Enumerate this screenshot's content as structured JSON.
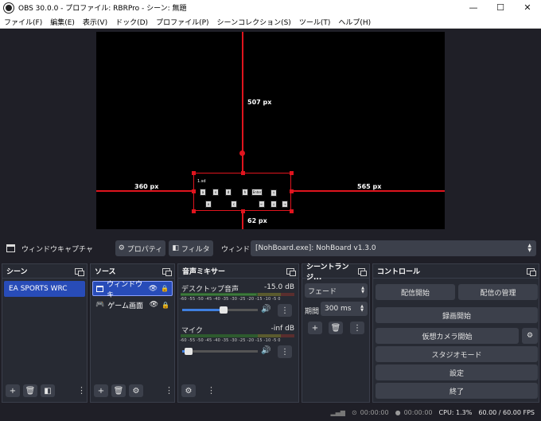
{
  "window": {
    "title": "OBS 30.0.0 - プロファイル: RBRPro - シーン: 無題",
    "minimize": "—",
    "maximize": "☐",
    "close": "✕"
  },
  "menu": [
    "ファイル(F)",
    "編集(E)",
    "表示(V)",
    "ドック(D)",
    "プロファイル(P)",
    "シーンコレクション(S)",
    "ツール(T)",
    "ヘルプ(H)"
  ],
  "preview": {
    "top_distance": "507 px",
    "left_distance": "360 px",
    "right_distance": "565 px",
    "bottom_distance": "62 px",
    "overlay_label": "1.sd",
    "keys": [
      "a",
      "s",
      "d",
      "h",
      "Enter",
      "↑",
      "x",
      "c",
      "←",
      "↓",
      "→"
    ]
  },
  "source_toolbar": {
    "selected_source": "ウィンドウキャプチャ",
    "properties_button": "プロパティ",
    "filters_button": "フィルタ",
    "window_label": "ウィンドウ",
    "window_value": "[NohBoard.exe]: NohBoard v1.3.0"
  },
  "scenes": {
    "title": "シーン",
    "items": [
      "EA SPORTS WRC"
    ]
  },
  "sources": {
    "title": "ソース",
    "items": [
      "ウィンドウキ",
      "ゲーム画面"
    ]
  },
  "mixer": {
    "title": "音声ミキサー",
    "scale": "-60 -55 -50 -45 -40 -35 -30 -25 -20 -15 -10 -5 0",
    "channels": [
      {
        "name": "デスクトップ音声",
        "level": "-15.0 dB",
        "volume": 0.55
      },
      {
        "name": "マイク",
        "level": "-inf dB",
        "volume": 0.08
      }
    ]
  },
  "transitions": {
    "title": "シーントランジ...",
    "type": "フェード",
    "duration_label": "期間",
    "duration_value": "300 ms"
  },
  "controls": {
    "title": "コントロール",
    "start_streaming": "配信開始",
    "manage_stream": "配信の管理",
    "start_recording": "録画開始",
    "start_virtualcam": "仮想カメラ開始",
    "studio_mode": "スタジオモード",
    "settings": "設定",
    "exit": "終了"
  },
  "status": {
    "stream_time": "00:00:00",
    "record_time": "00:00:00",
    "cpu": "CPU: 1.3%",
    "fps": "60.00 / 60.00 FPS"
  },
  "colors": {
    "accent": "#e0141e",
    "selected": "#284cb8",
    "panel": "#272a33",
    "background": "#1f1f27"
  }
}
